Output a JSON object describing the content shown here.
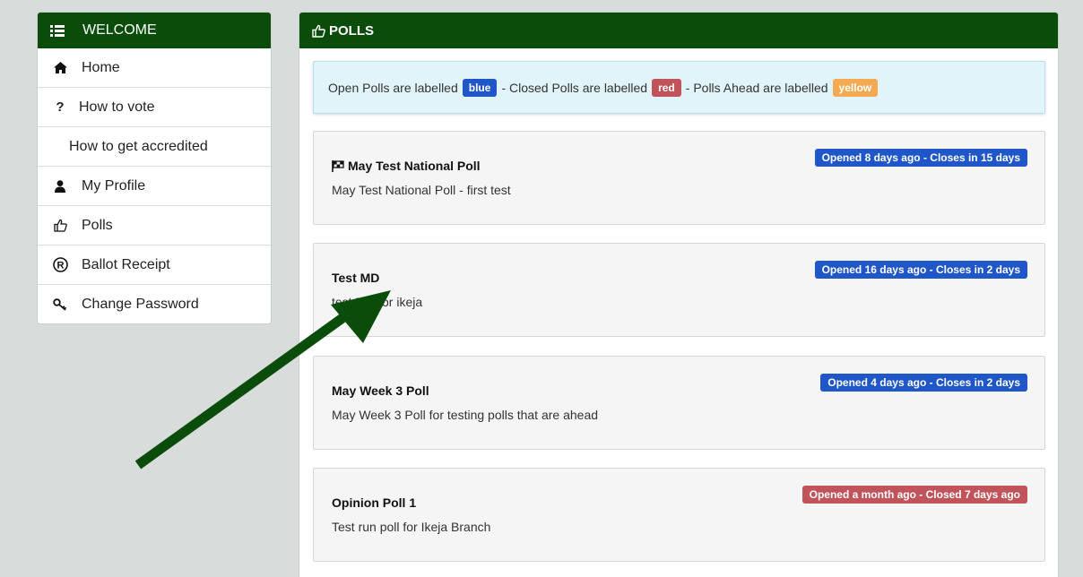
{
  "sidebar": {
    "header": "WELCOME",
    "items": [
      {
        "label": "Home"
      },
      {
        "label": "How to vote"
      },
      {
        "label": "How to get accredited"
      },
      {
        "label": "My Profile"
      },
      {
        "label": "Polls"
      },
      {
        "label": "Ballot Receipt"
      },
      {
        "label": "Change Password"
      }
    ]
  },
  "panel": {
    "title": "POLLS",
    "legend": {
      "open_text": "Open Polls are labelled",
      "open_tag": "blue",
      "closed_text": "- Closed Polls are labelled",
      "closed_tag": "red",
      "ahead_text": "- Polls Ahead are labelled",
      "ahead_tag": "yellow"
    },
    "polls": [
      {
        "title": "May Test National Poll",
        "description": "May Test National Poll - first test",
        "status": "Opened 8 days ago - Closes in 15 days",
        "state": "open"
      },
      {
        "title": "Test MD",
        "description": "test MD for ikeja",
        "status": "Opened 16 days ago - Closes in 2 days",
        "state": "open"
      },
      {
        "title": "May Week 3 Poll",
        "description": "May Week 3 Poll for testing polls that are ahead",
        "status": "Opened 4 days ago - Closes in 2 days",
        "state": "open"
      },
      {
        "title": "Opinion Poll 1",
        "description": "Test run poll for Ikeja Branch",
        "status": "Opened a month ago - Closed 7 days ago",
        "state": "closed"
      }
    ]
  },
  "colors": {
    "header_green": "#0a4d0a",
    "open_blue": "#1f56c8",
    "closed_red": "#c0545a",
    "ahead_yellow": "#f5a953",
    "annotation_arrow": "#0a4d0a"
  }
}
